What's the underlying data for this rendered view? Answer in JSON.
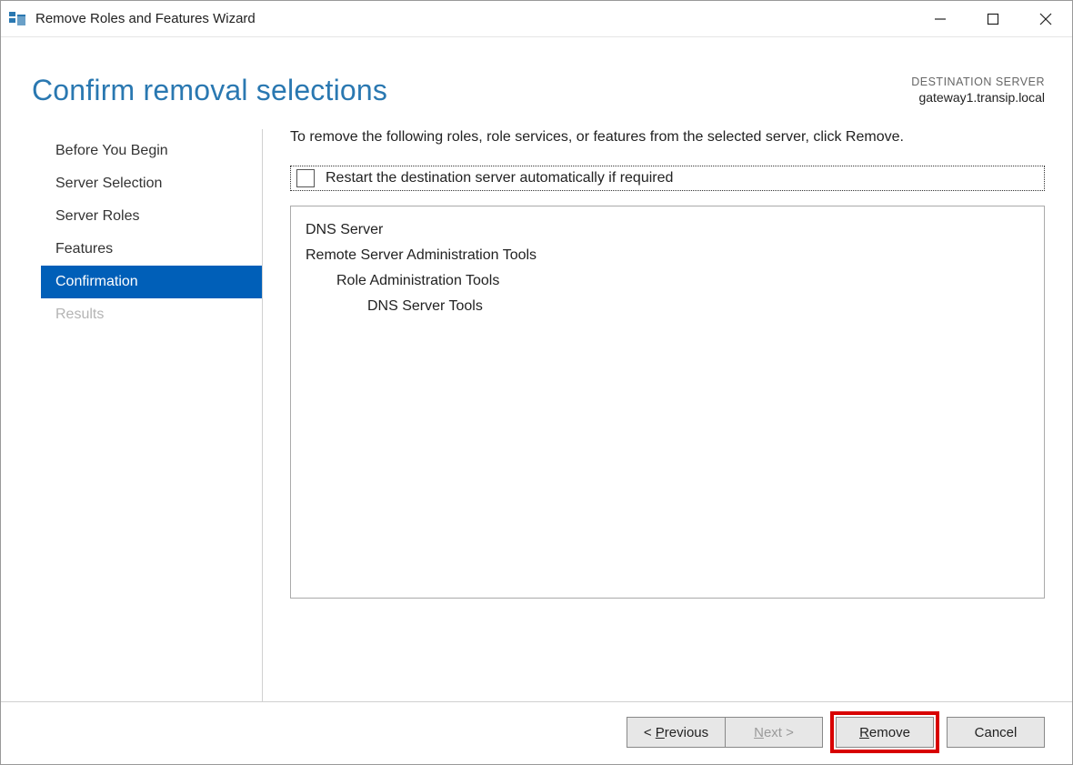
{
  "window": {
    "title": "Remove Roles and Features Wizard"
  },
  "header": {
    "page_title": "Confirm removal selections",
    "dest_label": "DESTINATION SERVER",
    "dest_server": "gateway1.transip.local"
  },
  "sidebar": {
    "items": [
      {
        "label": "Before You Begin",
        "state": "normal"
      },
      {
        "label": "Server Selection",
        "state": "normal"
      },
      {
        "label": "Server Roles",
        "state": "normal"
      },
      {
        "label": "Features",
        "state": "normal"
      },
      {
        "label": "Confirmation",
        "state": "selected"
      },
      {
        "label": "Results",
        "state": "disabled"
      }
    ]
  },
  "main": {
    "instruction": "To remove the following roles, role services, or features from the selected server, click Remove.",
    "restart_checkbox_label": "Restart the destination server automatically if required",
    "restart_checked": false,
    "removal_items": [
      {
        "text": "DNS Server",
        "level": 0
      },
      {
        "text": "Remote Server Administration Tools",
        "level": 0
      },
      {
        "text": "Role Administration Tools",
        "level": 1
      },
      {
        "text": "DNS Server Tools",
        "level": 2
      }
    ]
  },
  "footer": {
    "previous": "Previous",
    "next": "Next",
    "remove": "Remove",
    "cancel": "Cancel",
    "next_enabled": false,
    "highlighted": "remove"
  }
}
